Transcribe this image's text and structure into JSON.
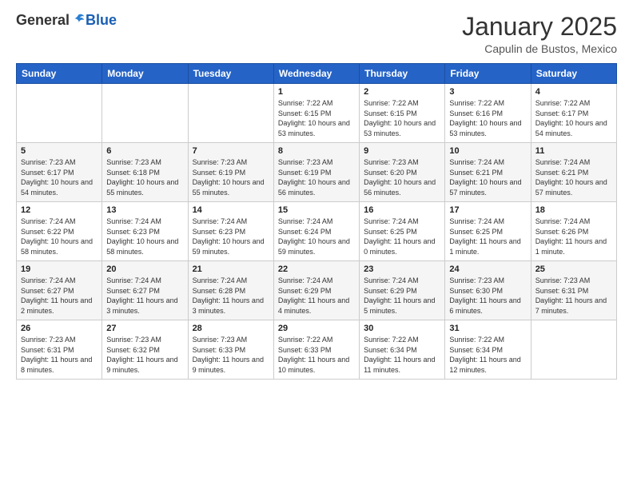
{
  "logo": {
    "general": "General",
    "blue": "Blue"
  },
  "header": {
    "title": "January 2025",
    "subtitle": "Capulin de Bustos, Mexico"
  },
  "weekdays": [
    "Sunday",
    "Monday",
    "Tuesday",
    "Wednesday",
    "Thursday",
    "Friday",
    "Saturday"
  ],
  "weeks": [
    [
      {
        "day": "",
        "sunrise": "",
        "sunset": "",
        "daylight": ""
      },
      {
        "day": "",
        "sunrise": "",
        "sunset": "",
        "daylight": ""
      },
      {
        "day": "",
        "sunrise": "",
        "sunset": "",
        "daylight": ""
      },
      {
        "day": "1",
        "sunrise": "Sunrise: 7:22 AM",
        "sunset": "Sunset: 6:15 PM",
        "daylight": "Daylight: 10 hours and 53 minutes."
      },
      {
        "day": "2",
        "sunrise": "Sunrise: 7:22 AM",
        "sunset": "Sunset: 6:15 PM",
        "daylight": "Daylight: 10 hours and 53 minutes."
      },
      {
        "day": "3",
        "sunrise": "Sunrise: 7:22 AM",
        "sunset": "Sunset: 6:16 PM",
        "daylight": "Daylight: 10 hours and 53 minutes."
      },
      {
        "day": "4",
        "sunrise": "Sunrise: 7:22 AM",
        "sunset": "Sunset: 6:17 PM",
        "daylight": "Daylight: 10 hours and 54 minutes."
      }
    ],
    [
      {
        "day": "5",
        "sunrise": "Sunrise: 7:23 AM",
        "sunset": "Sunset: 6:17 PM",
        "daylight": "Daylight: 10 hours and 54 minutes."
      },
      {
        "day": "6",
        "sunrise": "Sunrise: 7:23 AM",
        "sunset": "Sunset: 6:18 PM",
        "daylight": "Daylight: 10 hours and 55 minutes."
      },
      {
        "day": "7",
        "sunrise": "Sunrise: 7:23 AM",
        "sunset": "Sunset: 6:19 PM",
        "daylight": "Daylight: 10 hours and 55 minutes."
      },
      {
        "day": "8",
        "sunrise": "Sunrise: 7:23 AM",
        "sunset": "Sunset: 6:19 PM",
        "daylight": "Daylight: 10 hours and 56 minutes."
      },
      {
        "day": "9",
        "sunrise": "Sunrise: 7:23 AM",
        "sunset": "Sunset: 6:20 PM",
        "daylight": "Daylight: 10 hours and 56 minutes."
      },
      {
        "day": "10",
        "sunrise": "Sunrise: 7:24 AM",
        "sunset": "Sunset: 6:21 PM",
        "daylight": "Daylight: 10 hours and 57 minutes."
      },
      {
        "day": "11",
        "sunrise": "Sunrise: 7:24 AM",
        "sunset": "Sunset: 6:21 PM",
        "daylight": "Daylight: 10 hours and 57 minutes."
      }
    ],
    [
      {
        "day": "12",
        "sunrise": "Sunrise: 7:24 AM",
        "sunset": "Sunset: 6:22 PM",
        "daylight": "Daylight: 10 hours and 58 minutes."
      },
      {
        "day": "13",
        "sunrise": "Sunrise: 7:24 AM",
        "sunset": "Sunset: 6:23 PM",
        "daylight": "Daylight: 10 hours and 58 minutes."
      },
      {
        "day": "14",
        "sunrise": "Sunrise: 7:24 AM",
        "sunset": "Sunset: 6:23 PM",
        "daylight": "Daylight: 10 hours and 59 minutes."
      },
      {
        "day": "15",
        "sunrise": "Sunrise: 7:24 AM",
        "sunset": "Sunset: 6:24 PM",
        "daylight": "Daylight: 10 hours and 59 minutes."
      },
      {
        "day": "16",
        "sunrise": "Sunrise: 7:24 AM",
        "sunset": "Sunset: 6:25 PM",
        "daylight": "Daylight: 11 hours and 0 minutes."
      },
      {
        "day": "17",
        "sunrise": "Sunrise: 7:24 AM",
        "sunset": "Sunset: 6:25 PM",
        "daylight": "Daylight: 11 hours and 1 minute."
      },
      {
        "day": "18",
        "sunrise": "Sunrise: 7:24 AM",
        "sunset": "Sunset: 6:26 PM",
        "daylight": "Daylight: 11 hours and 1 minute."
      }
    ],
    [
      {
        "day": "19",
        "sunrise": "Sunrise: 7:24 AM",
        "sunset": "Sunset: 6:27 PM",
        "daylight": "Daylight: 11 hours and 2 minutes."
      },
      {
        "day": "20",
        "sunrise": "Sunrise: 7:24 AM",
        "sunset": "Sunset: 6:27 PM",
        "daylight": "Daylight: 11 hours and 3 minutes."
      },
      {
        "day": "21",
        "sunrise": "Sunrise: 7:24 AM",
        "sunset": "Sunset: 6:28 PM",
        "daylight": "Daylight: 11 hours and 3 minutes."
      },
      {
        "day": "22",
        "sunrise": "Sunrise: 7:24 AM",
        "sunset": "Sunset: 6:29 PM",
        "daylight": "Daylight: 11 hours and 4 minutes."
      },
      {
        "day": "23",
        "sunrise": "Sunrise: 7:24 AM",
        "sunset": "Sunset: 6:29 PM",
        "daylight": "Daylight: 11 hours and 5 minutes."
      },
      {
        "day": "24",
        "sunrise": "Sunrise: 7:23 AM",
        "sunset": "Sunset: 6:30 PM",
        "daylight": "Daylight: 11 hours and 6 minutes."
      },
      {
        "day": "25",
        "sunrise": "Sunrise: 7:23 AM",
        "sunset": "Sunset: 6:31 PM",
        "daylight": "Daylight: 11 hours and 7 minutes."
      }
    ],
    [
      {
        "day": "26",
        "sunrise": "Sunrise: 7:23 AM",
        "sunset": "Sunset: 6:31 PM",
        "daylight": "Daylight: 11 hours and 8 minutes."
      },
      {
        "day": "27",
        "sunrise": "Sunrise: 7:23 AM",
        "sunset": "Sunset: 6:32 PM",
        "daylight": "Daylight: 11 hours and 9 minutes."
      },
      {
        "day": "28",
        "sunrise": "Sunrise: 7:23 AM",
        "sunset": "Sunset: 6:33 PM",
        "daylight": "Daylight: 11 hours and 9 minutes."
      },
      {
        "day": "29",
        "sunrise": "Sunrise: 7:22 AM",
        "sunset": "Sunset: 6:33 PM",
        "daylight": "Daylight: 11 hours and 10 minutes."
      },
      {
        "day": "30",
        "sunrise": "Sunrise: 7:22 AM",
        "sunset": "Sunset: 6:34 PM",
        "daylight": "Daylight: 11 hours and 11 minutes."
      },
      {
        "day": "31",
        "sunrise": "Sunrise: 7:22 AM",
        "sunset": "Sunset: 6:34 PM",
        "daylight": "Daylight: 11 hours and 12 minutes."
      },
      {
        "day": "",
        "sunrise": "",
        "sunset": "",
        "daylight": ""
      }
    ]
  ]
}
